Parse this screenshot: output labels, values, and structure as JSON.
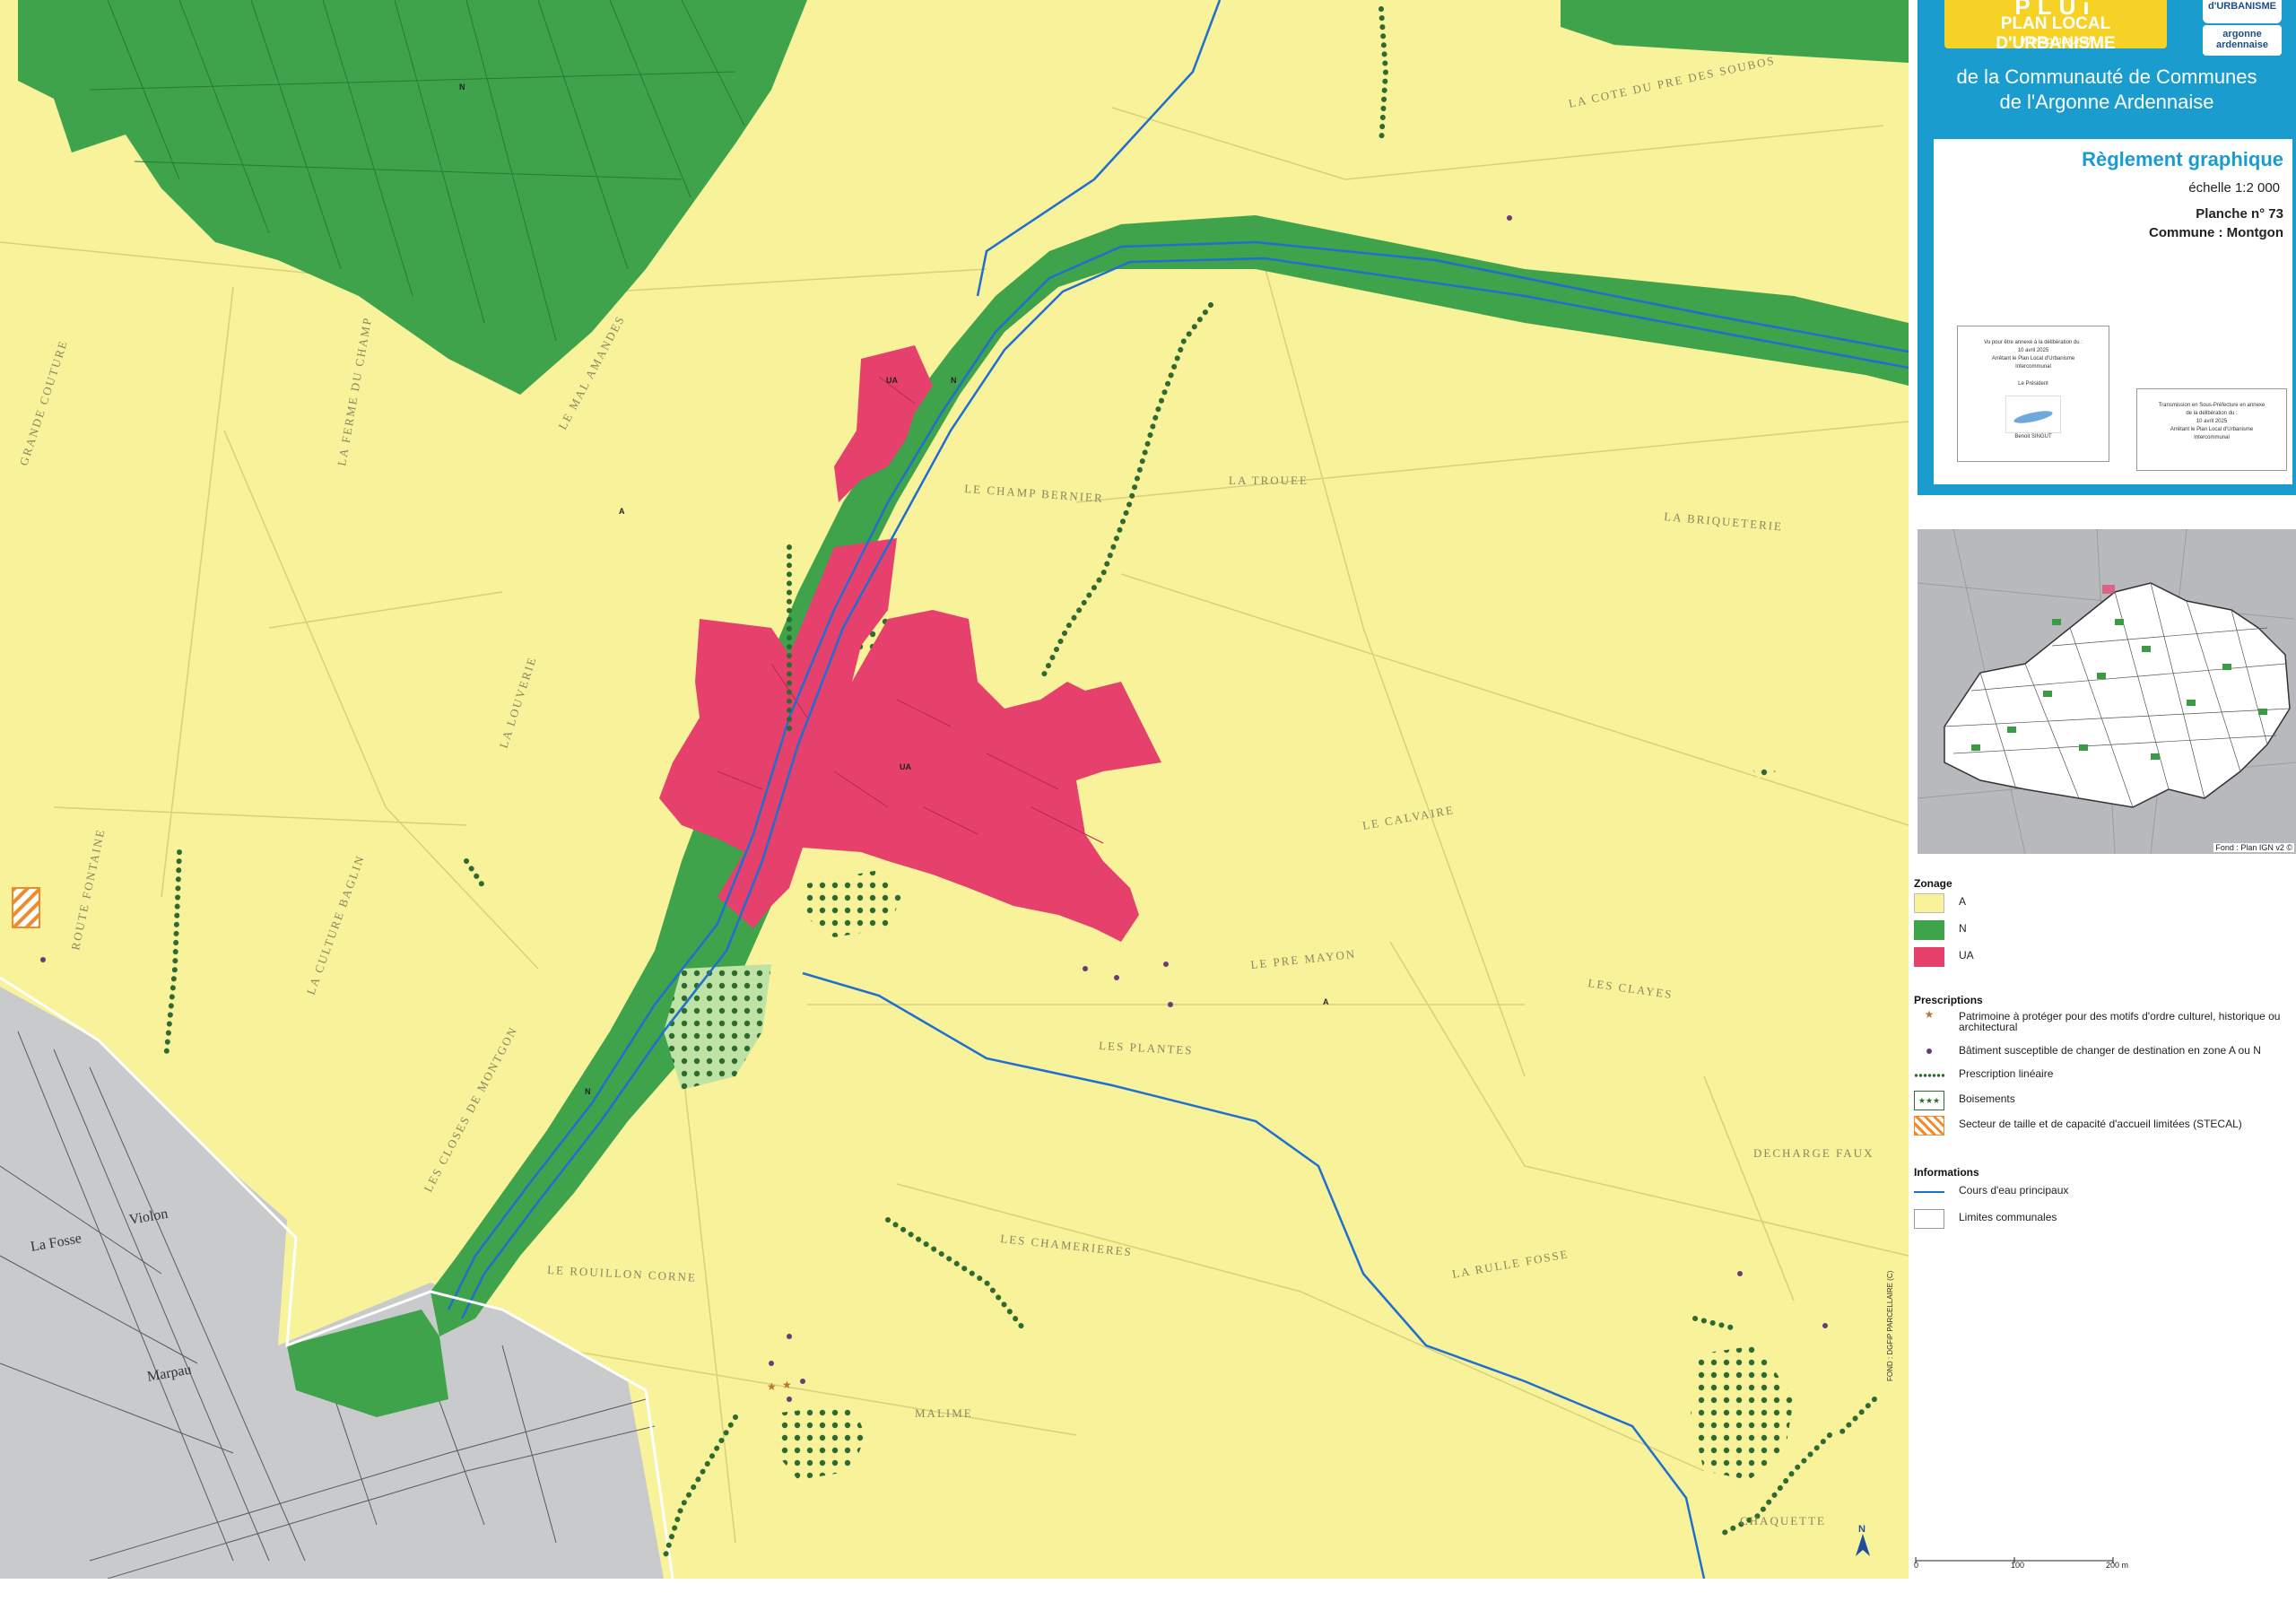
{
  "header": {
    "plui_word": "PLUi",
    "plu_title": "PLAN LOCAL D'URBANISME",
    "plu_subtitle": "intercommunal",
    "logo1_text": "d'URBANISME",
    "logo2_text": "argonne ardennaise",
    "community_line1": "de la Communauté de Communes",
    "community_line2": "de l'Argonne Ardennaise"
  },
  "titleblock": {
    "title": "Règlement graphique",
    "scale": "échelle  1:2 000",
    "planche": "Planche n° 73",
    "commune": "Commune : Montgon"
  },
  "stamps": {
    "left_lines": [
      "Vu pour être annexé à la délibération du :",
      "10 avril 2025",
      "Arrêtant le Plan Local d'Urbanisme",
      "Intercommunal",
      "Le Président",
      "Benoit SINGUT"
    ],
    "right_lines": [
      "Transmission en Sous-Préfecture en annexe",
      "de la délibération du :",
      "10 avril 2025",
      "Arrêtant le Plan Local d'Urbanisme",
      "Intercommunal"
    ]
  },
  "locator": {
    "source": "Fond : Plan IGN v2 ©"
  },
  "legend": {
    "zonage_title": "Zonage",
    "zones": [
      {
        "code": "A",
        "color": "#f8f29a"
      },
      {
        "code": "N",
        "color": "#3ea34a"
      },
      {
        "code": "UA",
        "color": "#e5416c"
      }
    ],
    "prescriptions_title": "Prescriptions",
    "prescriptions": [
      "Patrimoine à protéger pour des motifs d'ordre culturel, historique ou architectural",
      "Bâtiment susceptible de changer de destination en zone A ou N",
      "Prescription linéaire",
      "Boisements",
      "Secteur de taille et de capacité d'accueil limitées (STECAL)"
    ],
    "informations_title": "Informations",
    "informations": [
      "Cours d'eau principaux",
      "Limites communales"
    ]
  },
  "scalebar": {
    "labels": [
      "0",
      "100",
      "200 m"
    ]
  },
  "source_vertical": "FOND : DGFiP PARCELLAIRE (C)",
  "north": "N",
  "map_labels": {
    "zone_a": "A",
    "zone_n": "N",
    "zone_ua": "UA",
    "localities": [
      "LE CHAMP BERNIER",
      "LA TROUEE",
      "LA BRIQUETERIE",
      "LE CALVAIRE",
      "LE PRE MAYON",
      "LES PLANTES",
      "LES CLAYES",
      "LES CHAMERIERES",
      "LA RULLE FOSSE",
      "DECHARGE FAUX",
      "LA COTE DU PRE DES SOUBOS",
      "LE MAL AMANDES",
      "LES CLOSES DE MONTGON",
      "LA CULTURE BAGLIN",
      "ROUTE FONTAINE",
      "LA LOUVERIE",
      "GRANDE COUTURE",
      "LA FERME DU CHAMP",
      "LE ROUILLON CORNE",
      "MALIME",
      "CHAQUETTE",
      "La Fosse",
      "Violon",
      "Marpau"
    ]
  },
  "colors": {
    "zone_a": "#f8f29a",
    "zone_n": "#3ea34a",
    "zone_ua": "#e5416c",
    "cadastre_grey": "#c9cacc",
    "watercourse": "#1f6fd1",
    "prescription_dots": "#3f7a3a",
    "header_blue": "#1a9ccf"
  }
}
